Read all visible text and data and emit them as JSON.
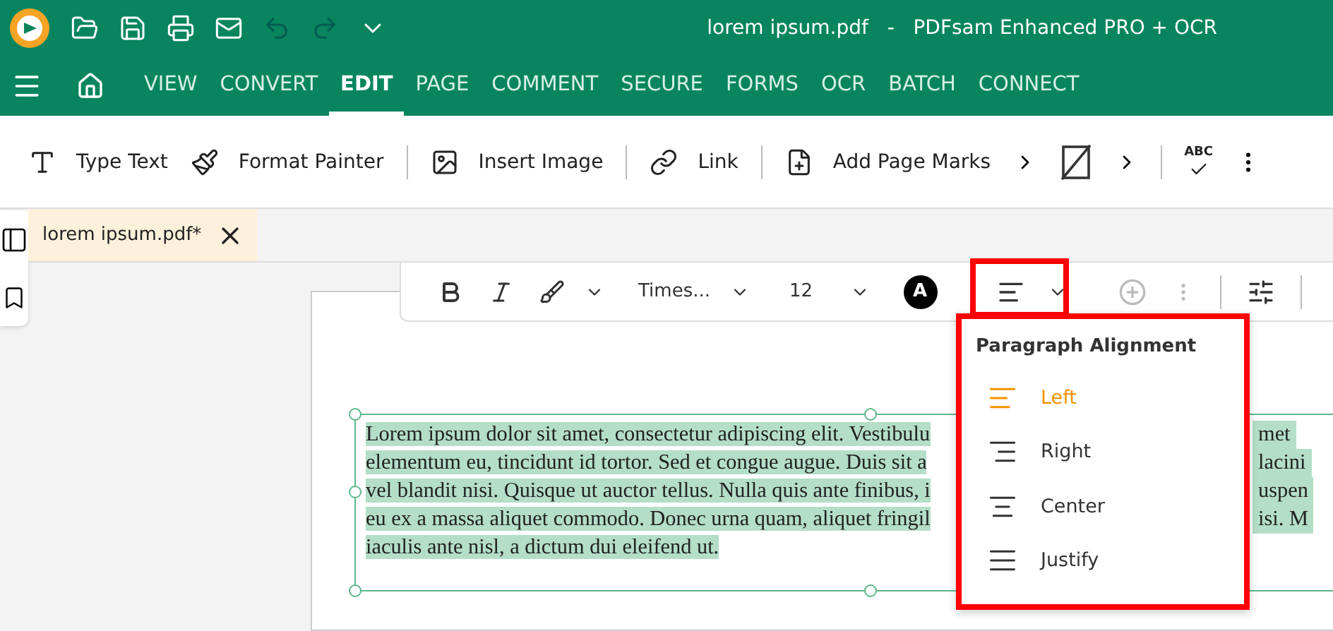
{
  "window": {
    "title": "lorem ipsum.pdf   -   PDFsam Enhanced PRO + OCR"
  },
  "menu_tabs": [
    {
      "label": "VIEW",
      "selected": false
    },
    {
      "label": "CONVERT",
      "selected": false
    },
    {
      "label": "EDIT",
      "selected": true
    },
    {
      "label": "PAGE",
      "selected": false
    },
    {
      "label": "COMMENT",
      "selected": false
    },
    {
      "label": "SECURE",
      "selected": false
    },
    {
      "label": "FORMS",
      "selected": false
    },
    {
      "label": "OCR",
      "selected": false
    },
    {
      "label": "BATCH",
      "selected": false
    },
    {
      "label": "CONNECT",
      "selected": false
    }
  ],
  "toolbar": [
    {
      "kind": "type",
      "label": "Type Text"
    },
    {
      "kind": "painter",
      "label": "Format Painter"
    },
    {
      "kind": "sep"
    },
    {
      "kind": "image",
      "label": "Insert Image"
    },
    {
      "kind": "sep"
    },
    {
      "kind": "link",
      "label": "Link"
    },
    {
      "kind": "sep"
    },
    {
      "kind": "marks",
      "label": "Add Page Marks"
    },
    {
      "kind": "more"
    },
    {
      "kind": "nosign"
    },
    {
      "kind": "more"
    },
    {
      "kind": "sep"
    },
    {
      "kind": "spell",
      "label": "ABC"
    },
    {
      "kind": "dots"
    }
  ],
  "document_tab": {
    "label": "lorem ipsum.pdf*"
  },
  "format_bar": {
    "font": "Times...",
    "size": "12",
    "color_letter": "A"
  },
  "text_lines": [
    {
      "left": "Lorem ipsum dolor sit amet, consectetur adipiscing elit. Vestibulu",
      "right": "met"
    },
    {
      "left": "elementum eu, tincidunt id tortor. Sed et congue augue. Duis sit a",
      "right": "lacini"
    },
    {
      "left": "vel blandit nisi. Quisque ut auctor tellus. Nulla quis ante finibus, i",
      "right": "uspen"
    },
    {
      "left": "eu ex a massa aliquet commodo. Donec urna quam, aliquet fringil",
      "right": "isi. M"
    },
    {
      "left": "iaculis ante nisl, a dictum dui eleifend ut."
    }
  ],
  "alignment_menu": {
    "title": "Paragraph Alignment",
    "items": [
      {
        "kind": "left",
        "label": "Left",
        "selected": true
      },
      {
        "kind": "right",
        "label": "Right",
        "selected": false
      },
      {
        "kind": "center",
        "label": "Center",
        "selected": false
      },
      {
        "kind": "justify",
        "label": "Justify",
        "selected": false
      }
    ]
  }
}
